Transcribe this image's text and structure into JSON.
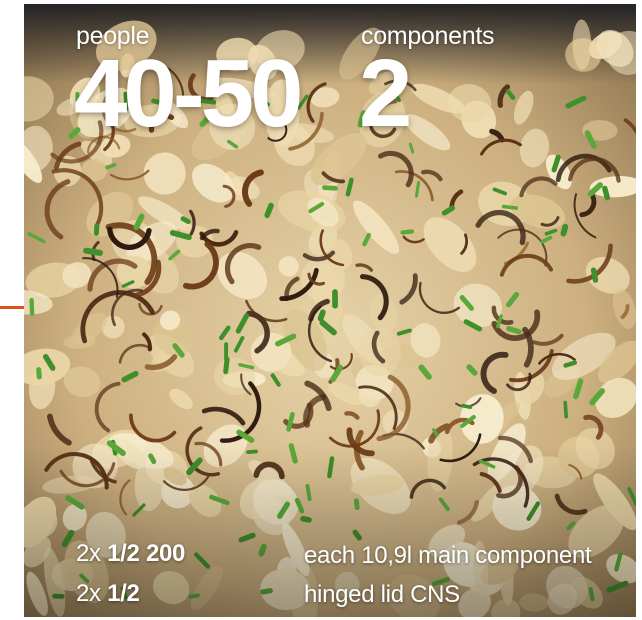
{
  "stats": {
    "people": {
      "label": "people",
      "value": "40-50"
    },
    "components": {
      "label": "components",
      "value": "2"
    }
  },
  "specs": [
    {
      "qty": "2x",
      "size": "1/2 200",
      "description": "each 10,9l main component"
    },
    {
      "qty": "2x",
      "size": "1/2",
      "description": "hinged lid CNS"
    }
  ],
  "colors": {
    "accent": "#d9541e",
    "text": "#ffffff"
  }
}
